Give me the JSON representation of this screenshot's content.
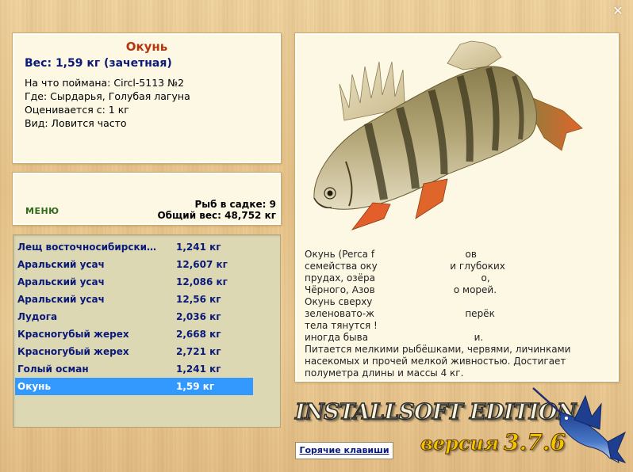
{
  "window": {
    "close_glyph": "✕"
  },
  "fish": {
    "title": "Окунь",
    "weight": "Вес: 1,59 кг (зачетная)",
    "info": [
      {
        "label": "На что поймана:",
        "value": "Circl-5113 №2"
      },
      {
        "label": "Где:",
        "value": "Сырдарья, Голубая лагуна"
      },
      {
        "label": "Оценивается с:",
        "value": "1 кг"
      },
      {
        "label": "Вид:",
        "value": "Ловится часто"
      }
    ],
    "description": "Окунь (Perca f… семейства оку… прудах, озёра… Чёрного, Азов… Окунь сверху зеленовато-ж… тела тянутся … иногда бываю… Питается мелкими рыбёшками, червями, личинками насекомых и прочей мелкой живностью. Достигает полуметра длины и массы 4 кг.",
    "description_lines": [
      "Окунь (Perca f                              ов",
      "семейства оку                        и глубоких",
      "прудах, озёра                                   о,",
      "Чёрного, Азов                          о морей.",
      "Окунь сверху",
      "зеленовато-ж                              перёк",
      "тела тянутся !",
      "иногда быва                                   и.",
      "Питается мелкими рыбёшками, червями, личинками",
      "насекомых и прочей мелкой живностью. Достигает",
      "полуметра длины и массы 4 кг."
    ]
  },
  "menu": {
    "menu_label": "МЕНЮ",
    "fish_in_net": "Рыб в садке: 9",
    "total_weight": "Общий вес: 48,752 кг"
  },
  "catch_list": [
    {
      "name": "Лещ восточносибирски…",
      "weight": "1,241 кг",
      "selected": false
    },
    {
      "name": "Аральский усач",
      "weight": "12,607 кг",
      "selected": false
    },
    {
      "name": "Аральский усач",
      "weight": "12,086 кг",
      "selected": false
    },
    {
      "name": "Аральский усач",
      "weight": "12,56 кг",
      "selected": false
    },
    {
      "name": "Лудога",
      "weight": "2,036 кг",
      "selected": false
    },
    {
      "name": "Красногубый жерех",
      "weight": "2,668 кг",
      "selected": false
    },
    {
      "name": "Красногубый жерех",
      "weight": "2,721 кг",
      "selected": false
    },
    {
      "name": "Голый осман",
      "weight": "1,241 кг",
      "selected": false
    },
    {
      "name": "Окунь",
      "weight": "1,59 кг",
      "selected": true
    }
  ],
  "footer": {
    "hotkeys_label": "Горячие клавиши",
    "logo_edition": "INSTALLSOFT EDITION",
    "logo_version_word": "версия",
    "logo_version_number": "3.7.6"
  },
  "colors": {
    "title_red": "#b5360d",
    "text_blue": "#0b1a7a",
    "menu_green": "#2e6b1a",
    "selection_blue": "#3399ff",
    "list_background": "#ddd8b4",
    "panel_background": "#fdf8e4"
  }
}
